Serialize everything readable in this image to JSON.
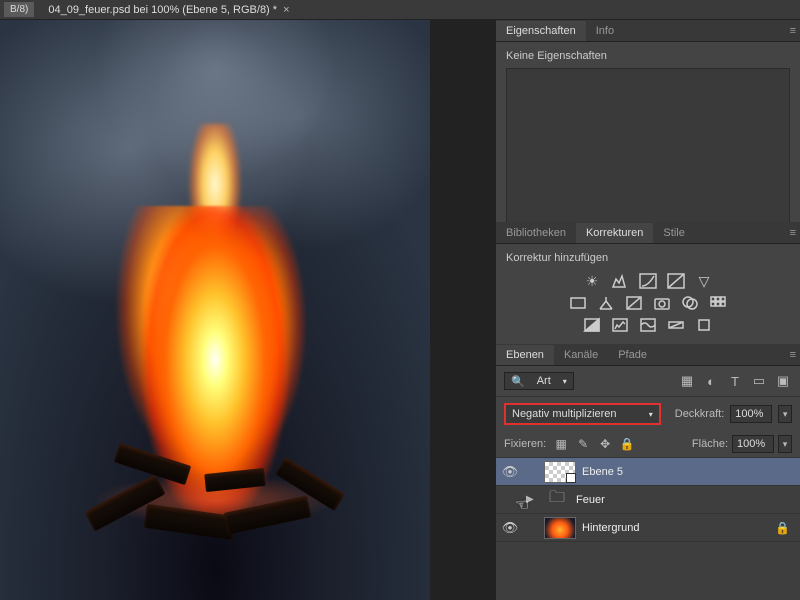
{
  "tabs": {
    "mode": "B/8)",
    "title": "04_09_feuer.psd bei 100% (Ebene 5, RGB/8) *"
  },
  "panels": {
    "properties": {
      "tabs": [
        "Eigenschaften",
        "Info"
      ],
      "empty": "Keine Eigenschaften"
    },
    "adjustments": {
      "tabs": [
        "Bibliotheken",
        "Korrekturen",
        "Stile"
      ],
      "label": "Korrektur hinzufügen"
    },
    "layers": {
      "tabs": [
        "Ebenen",
        "Kanäle",
        "Pfade"
      ],
      "filter": "Art",
      "blend_mode": "Negativ multiplizieren",
      "opacity_label": "Deckkraft:",
      "opacity": "100%",
      "lock_label": "Fixieren:",
      "fill_label": "Fläche:",
      "fill": "100%",
      "items": [
        {
          "name": "Ebene 5",
          "visible": true,
          "selected": true,
          "type": "pixel"
        },
        {
          "name": "Feuer",
          "visible": false,
          "type": "group"
        },
        {
          "name": "Hintergrund",
          "visible": true,
          "locked": true,
          "type": "pixel"
        }
      ]
    }
  }
}
